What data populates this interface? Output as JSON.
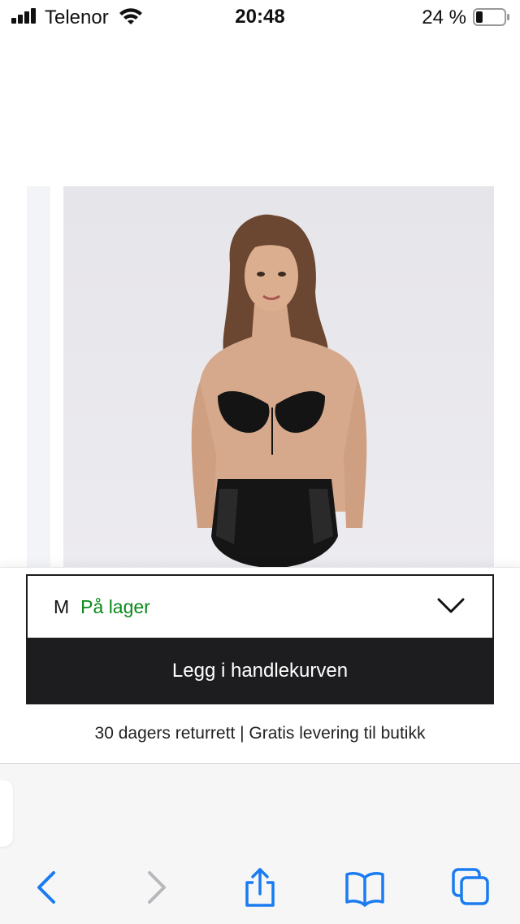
{
  "status_bar": {
    "carrier": "Telenor",
    "time": "20:48",
    "battery_percent": "24 %",
    "battery_level": 0.24,
    "signal_icon": "signal-bars-icon",
    "wifi_icon": "wifi-icon",
    "battery_icon": "battery-icon"
  },
  "product": {
    "image_icon": "product-photo"
  },
  "purchase": {
    "size": "M",
    "stock_status": "På lager",
    "stock_color": "#0b8a1a",
    "add_to_cart_label": "Legg i handlekurven",
    "button_color": "#1d1d1f",
    "info_text": "30 dagers returrett | Gratis levering til butikk"
  },
  "browser": {
    "accent": "#1a7cf0",
    "back_icon": "chevron-left-icon",
    "forward_icon": "chevron-right-icon",
    "share_icon": "share-icon",
    "bookmarks_icon": "book-icon",
    "tabs_icon": "tabs-icon"
  }
}
